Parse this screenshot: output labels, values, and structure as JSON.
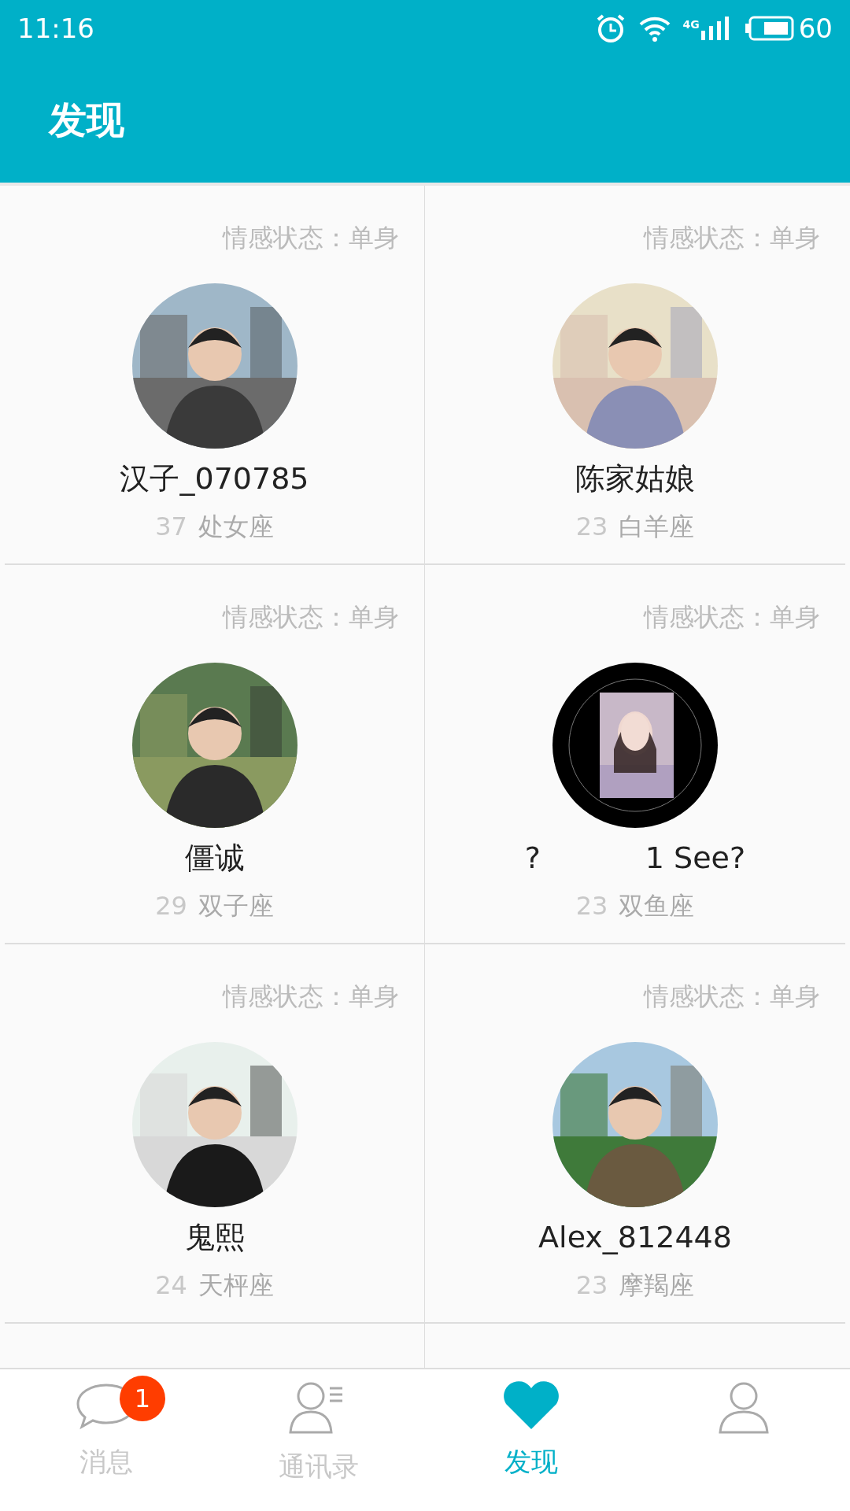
{
  "status_bar": {
    "time": "11:16",
    "network": "4G",
    "battery": "60"
  },
  "app_bar": {
    "title": "发现"
  },
  "users": [
    {
      "status_label": "情感状态：",
      "status": "单身",
      "name": "汉子_070785",
      "age": "37",
      "zodiac": "处女座"
    },
    {
      "status_label": "情感状态：",
      "status": "单身",
      "name": "陈家姑娘",
      "age": "23",
      "zodiac": "白羊座"
    },
    {
      "status_label": "情感状态：",
      "status": "单身",
      "name": "僵诚",
      "age": "29",
      "zodiac": "双子座"
    },
    {
      "status_label": "情感状态：",
      "status": "单身",
      "name": "?           1 See?",
      "age": "23",
      "zodiac": "双鱼座",
      "avatar": {
        "kind": "framed-picture"
      }
    },
    {
      "status_label": "情感状态：",
      "status": "单身",
      "name": "鬼熙",
      "age": "24",
      "zodiac": "天枰座"
    },
    {
      "status_label": "情感状态：",
      "status": "单身",
      "name": "Alex_812448",
      "age": "23",
      "zodiac": "摩羯座"
    }
  ],
  "tabs": [
    {
      "kind": "chat",
      "label": "消息",
      "badge": "1",
      "selected": false
    },
    {
      "kind": "contacts",
      "label": "通讯录",
      "selected": false
    },
    {
      "kind": "heart",
      "label": "发现",
      "selected": true
    },
    {
      "kind": "person",
      "selected": false
    }
  ]
}
